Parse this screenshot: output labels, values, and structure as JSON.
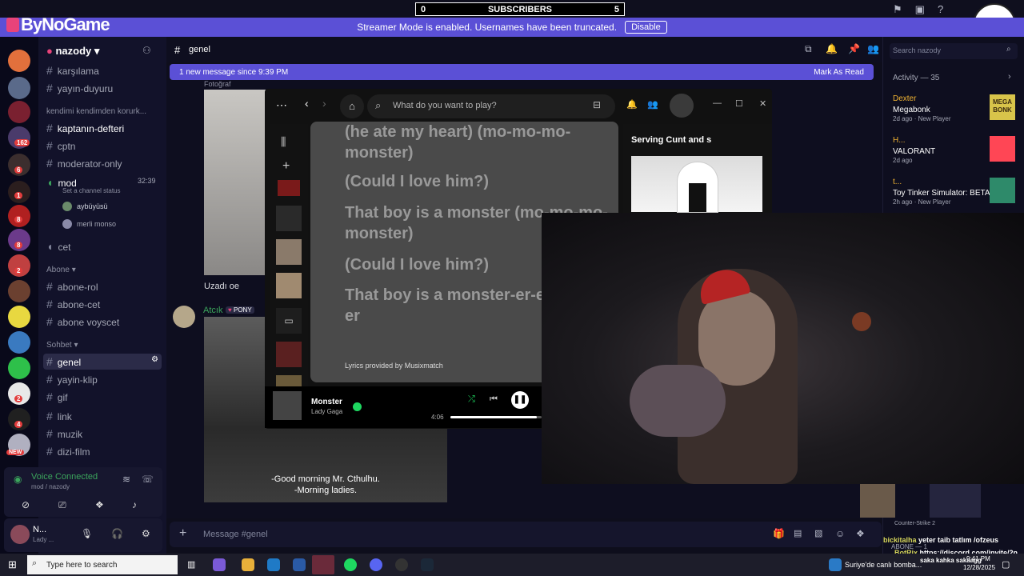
{
  "overlay": {
    "subscribers_label": "SUBSCRIBERS",
    "subscribers_left": "0",
    "subscribers_right": "5",
    "brand": "ByNoGame"
  },
  "banner": {
    "text": "Streamer Mode is enabled. Usernames have been truncated.",
    "button": "Disable"
  },
  "server_badges": [
    "162",
    "6",
    "1",
    "8",
    "8",
    "2",
    "2",
    "4",
    "NEW"
  ],
  "sidebar": {
    "server_name": "nazody",
    "top_channels": [
      "karşılama",
      "yayın-duyuru"
    ],
    "category1": "kendimi kendimden korurk...",
    "cat1_channels": [
      "kaptanın-defteri",
      "cptn",
      "moderator-only"
    ],
    "voice_channel": {
      "name": "mod",
      "time": "32:39",
      "status": "Set a channel status",
      "members": [
        "aybüyüsü",
        "merli monso"
      ]
    },
    "cet": "cet",
    "category2": "Abone",
    "cat2_channels": [
      "abone-rol",
      "abone-cet",
      "abone voyscet"
    ],
    "category3": "Sohbet",
    "cat3_channels": [
      "genel",
      "yayin-klip",
      "gif",
      "link",
      "muzik",
      "dizi-film"
    ],
    "voice_connected": "Voice Connected",
    "voice_sub": "mod / nazody",
    "user_name": "N...",
    "user_sub": "Lady ..."
  },
  "chat": {
    "channel": "genel",
    "new_messages": "1 new message since 9:39 PM",
    "mark_read": "Mark As Read",
    "message_placeholder": "Message #genel",
    "cropped_label": "Fotoğraf",
    "msg1_caption": "Uzadı oe",
    "msg2_author": "Atcık",
    "msg2_badge": "PONY",
    "subtitle1": "-Good morning Mr. Cthulhu.",
    "subtitle2": "-Morning ladies."
  },
  "right": {
    "search_placeholder": "Search nazody",
    "activity": "Activity — 35",
    "items": [
      {
        "name": "Dexter",
        "game": "Megabonk",
        "meta": "2d ago",
        "tag": "New Player",
        "art": "MEGA BONK"
      },
      {
        "name": "H...",
        "game": "VALORANT",
        "meta": "2d ago",
        "tag": ""
      },
      {
        "name": "t...",
        "game": "Toy Tinker Simulator: BETA",
        "meta": "2h ago",
        "tag": "New Player"
      }
    ]
  },
  "spotify": {
    "search_placeholder": "What do you want to play?",
    "lyrics": [
      "(he ate my heart) (mo-mo-mo-monster)",
      "(Could I love him?)",
      "That boy is a monster (mo-mo-mo-monster)",
      "(Could I love him?)",
      "That boy is a monster-er-er-er-er-er"
    ],
    "provider": "Lyrics provided by Musixmatch",
    "panel_title": "Serving Cunt and s",
    "track": "Monster",
    "artist": "Lady Gaga",
    "time": "4:06",
    "progress": 0.95
  },
  "game_overlay": {
    "label": "Counter-Strike 2",
    "abone": "ABONE — 1"
  },
  "twitch_chat": [
    {
      "user": "bickitalha",
      "msg": "yeter taib tatlım /ofzeus"
    },
    {
      "user": "BotRix",
      "msg": "https://discord.com/invite/2n"
    },
    {
      "user": "",
      "msg": "saka kahka sakaagg"
    }
  ],
  "taskbar": {
    "search": "Type here to search",
    "news": "Suriye'de canlı bomba...",
    "time": "9:41 PM",
    "date": "12/28/2025"
  },
  "colors": {
    "accent": "#5b50d6",
    "spotify_green": "#1ed760"
  }
}
